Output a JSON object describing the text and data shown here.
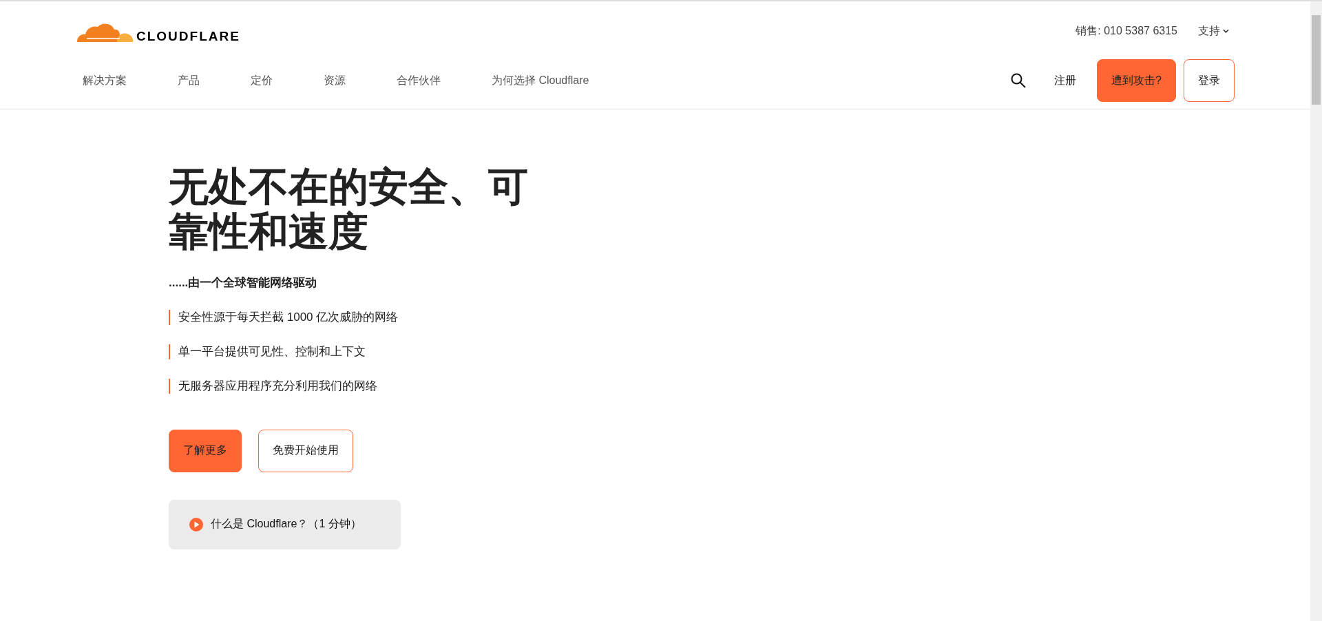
{
  "logo": {
    "wordmark": "CLOUDFLARE"
  },
  "nav": {
    "items": [
      "解决方案",
      "产品",
      "定价",
      "资源",
      "合作伙伴",
      "为何选择 Cloudflare"
    ]
  },
  "utility": {
    "sales": "销售: 010 5387 6315",
    "support": "支持"
  },
  "actions": {
    "signup": "注册",
    "attack": "遭到攻击?",
    "login": "登录"
  },
  "hero": {
    "title": "无处不在的安全、可靠性和速度",
    "subtitle": "......由一个全球智能网络驱动",
    "bullets": [
      "安全性源于每天拦截 1000 亿次威胁的网络",
      "单一平台提供可见性、控制和上下文",
      "无服务器应用程序充分利用我们的网络"
    ],
    "buttons": [
      {
        "label": "了解更多",
        "kind": "primary"
      },
      {
        "label": "免费开始使用",
        "kind": "outline"
      }
    ],
    "video": {
      "label": "什么是 Cloudflare？（1 分钟）"
    }
  }
}
